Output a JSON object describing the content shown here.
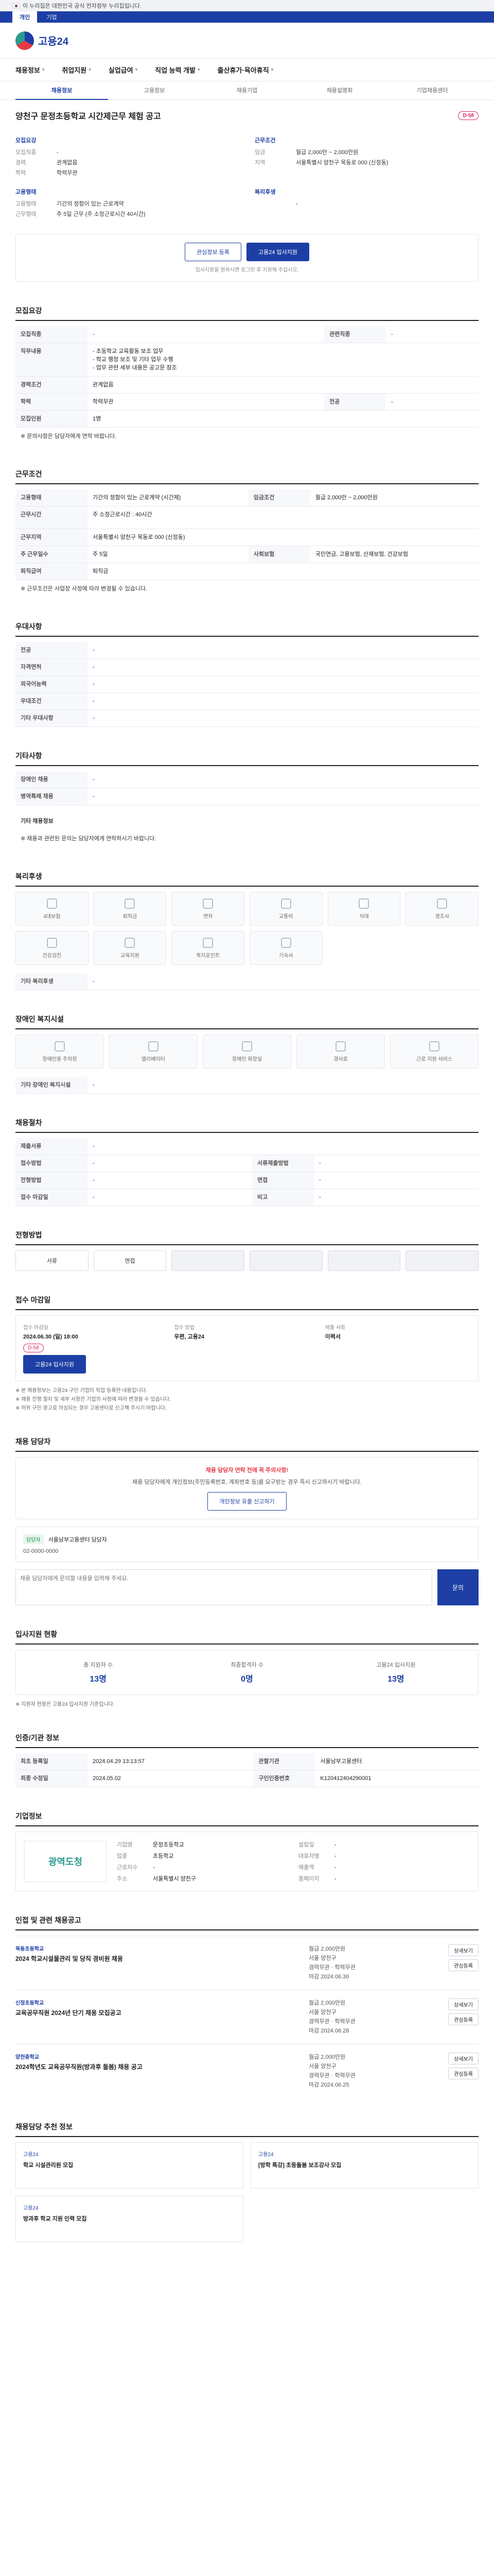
{
  "gov_banner": "이 누리집은 대한민국 공식 전자정부 누리집입니다.",
  "top_tabs": [
    "개인",
    "기업"
  ],
  "logo": "고용24",
  "gnb": [
    "채용정보",
    "취업지원",
    "실업급여",
    "직업 능력 개발",
    "출산휴가·육아휴직"
  ],
  "subtabs": [
    "채용정보",
    "고용정보",
    "채용기업",
    "채용설명회",
    "기업채용센터"
  ],
  "job": {
    "title": "양천구 문정초등학교 시간제근무 체험 공고",
    "dday": "D-58"
  },
  "summary": {
    "left_title": "모집요강",
    "left": [
      {
        "k": "모집직종",
        "v": "-"
      },
      {
        "k": "경력",
        "v": "관계없음"
      },
      {
        "k": "학력",
        "v": "학력무관"
      }
    ],
    "right_title": "근무조건",
    "right": [
      {
        "k": "임금",
        "v": "월급 2,000만 ~ 2,000만원"
      },
      {
        "k": "지역",
        "v": "서울특별시 양천구 목동로 000 (신정동)"
      }
    ],
    "left2_title": "고용형태",
    "left2": [
      {
        "k": "고용형태",
        "v": "기간의 정함이 있는 근로계약"
      },
      {
        "k": "근무형태",
        "v": "주 5일 근무 (주 소정근로시간 40시간)"
      }
    ],
    "right2_title": "복리후생",
    "right2": [
      {
        "k": "",
        "v": "-"
      }
    ]
  },
  "cta": {
    "scrap": "관심정보 등록",
    "apply": "고용24 입사지원",
    "note": "입사지원을 원하시면 로그인 후 지원해 주십시오."
  },
  "recruit_section": {
    "title": "모집요강",
    "rows": [
      {
        "k": "모집직종",
        "v": "-",
        "k2": "관련직종",
        "v2": "-"
      },
      {
        "k": "직무내용",
        "v": "- 초등학교 교육활동 보조 업무\n- 학교 행정 보조 및 기타 업무 수행\n- 업무 관련 세부 내용은 공고문 참조",
        "k2": "",
        "v2": ""
      },
      {
        "k": "경력조건",
        "v": "관계없음",
        "k2": "",
        "v2": ""
      },
      {
        "k": "학력",
        "v": "학력무관",
        "k2": "전공",
        "v2": "-"
      },
      {
        "k": "모집인원",
        "v": "1명",
        "k2": "",
        "v2": ""
      }
    ],
    "note": "※ 문의사항은 담당자에게 연락 바랍니다."
  },
  "condition_section": {
    "title": "근무조건",
    "rows": [
      {
        "k": "고용형태",
        "v": "기간의 정함이 있는 근로계약 (시간제)",
        "k2": "임금조건",
        "v2": "월급 2,000만 ~ 2,000만원"
      },
      {
        "k": "근무시간",
        "v": "주 소정근로시간 : 40시간",
        "k2": "",
        "v2": ""
      },
      {
        "k": "근무지역",
        "v": "서울특별시 양천구 목동로 000 (신정동)",
        "k2": "",
        "v2": ""
      },
      {
        "k": "주 근무일수",
        "v": "주 5일",
        "k2": "사회보험",
        "v2": "국민연금, 고용보험, 산재보험, 건강보험"
      },
      {
        "k": "퇴직급여",
        "v": "퇴직금",
        "k2": "",
        "v2": ""
      }
    ],
    "note": "※ 근무조건은 사업장 사정에 따라 변경될 수 있습니다."
  },
  "qualification_section": {
    "title": "우대사항",
    "rows": [
      {
        "k": "전공",
        "v": "-"
      },
      {
        "k": "자격면허",
        "v": "-"
      },
      {
        "k": "외국어능력",
        "v": "-"
      },
      {
        "k": "우대조건",
        "v": "-"
      },
      {
        "k": "기타 우대사항",
        "v": "-"
      }
    ]
  },
  "other_section": {
    "title": "기타사항",
    "rows": [
      {
        "k": "장애인 채용",
        "v": "-"
      },
      {
        "k": "병역특례 채용",
        "v": "-"
      }
    ],
    "extra_title": "기타 채용정보",
    "extra": "※ 채용과 관련된 문의는 담당자에게 연락하시기 바랍니다."
  },
  "welfare_section": {
    "title": "복리후생",
    "items": [
      "4대보험",
      "퇴직금",
      "연차",
      "교통비",
      "식대",
      "경조사",
      "건강검진",
      "교육지원",
      "복지포인트",
      "기숙사"
    ],
    "extra_label": "기타 복리후생",
    "extra": "-"
  },
  "disability_section": {
    "title": "장애인 복지시설",
    "items": [
      "장애인용 주차장",
      "엘리베이터",
      "장애인 화장실",
      "경사로",
      "근로 지원 서비스"
    ],
    "extra_label": "기타 장애인 복지시설",
    "extra": "-"
  },
  "process_section": {
    "title": "채용절차",
    "rows": [
      {
        "k": "제출서류",
        "v": "-"
      },
      {
        "k": "접수방법",
        "v": "-",
        "k2": "서류제출방법",
        "v2": "-"
      },
      {
        "k": "전형방법",
        "v": "-",
        "k2": "면접",
        "v2": "-"
      },
      {
        "k": "접수 마감일",
        "v": "-",
        "k2": "비고",
        "v2": "-"
      }
    ]
  },
  "steps_section": {
    "title": "전형방법",
    "steps": [
      "서류",
      "면접",
      "",
      "",
      "",
      ""
    ]
  },
  "apply_section": {
    "title": "접수 마감일",
    "items": [
      {
        "lbl": "접수 마감일",
        "val": "2024.06.30 (일) 18:00"
      },
      {
        "lbl": "접수 방법",
        "val": "우편, 고용24"
      },
      {
        "lbl": "제출 서류",
        "val": "이력서"
      }
    ],
    "dday": "D-58",
    "apply_btn": "고용24 입사지원",
    "notes": [
      "※ 본 채용정보는 고용24 구인 기업이 직접 등록한 내용입니다.",
      "※ 채용 진행 절차 및 세부 사항은 기업의 사정에 따라 변경될 수 있습니다.",
      "※ 허위 구인 광고로 의심되는 경우 고용센터로 신고해 주시기 바랍니다."
    ]
  },
  "contact_section": {
    "title": "채용 담당자",
    "warn_head": "채용 담당자 연락 전에 꼭 주의사항!",
    "warn_text": "채용 담당자에게 개인정보(주민등록번호, 계좌번호 등)를 요구받는 경우 즉시 신고하시기 바랍니다.",
    "warn_btn": "개인정보 유출 신고하기",
    "tag": "담당자",
    "contact": "서울남부고용센터 담당자",
    "phone": "02-0000-0000",
    "inquiry_placeholder": "채용 담당자에게 문의할 내용을 입력해 주세요.",
    "send": "문의"
  },
  "stats_section": {
    "title": "입사지원 현황",
    "items": [
      {
        "sl": "총 지원자 수",
        "sv": "13명"
      },
      {
        "sl": "최종합격자 수",
        "sv": "0명"
      },
      {
        "sl": "고용24 입사지원",
        "sv": "13명"
      }
    ],
    "note": "※ 지원자 현황은 고용24 입사지원 기준입니다."
  },
  "info_section": {
    "title": "인증/기관 정보",
    "rows": [
      {
        "k": "최초 등록일",
        "v": "2024.04.29 13:13:57",
        "k2": "관할기관",
        "v2": "서울남부고용센터"
      },
      {
        "k": "최종 수정일",
        "v": "2024.05.02",
        "k2": "구인인증번호",
        "v2": "K120412404290001"
      }
    ]
  },
  "company_section": {
    "title": "기업정보",
    "logo": "광역도청",
    "rows": [
      {
        "k": "기업명",
        "v": "문정초등학교",
        "k2": "설립일",
        "v2": "-"
      },
      {
        "k": "업종",
        "v": "초등학교",
        "k2": "대표자명",
        "v2": "-"
      },
      {
        "k": "근로자수",
        "v": "-",
        "k2": "매출액",
        "v2": "-"
      },
      {
        "k": "주소",
        "v": "서울특별시 양천구",
        "k2": "홈페이지",
        "v2": "-"
      }
    ]
  },
  "related_section": {
    "title": "인접 및 관련 채용공고",
    "items": [
      {
        "org": "목동초등학교",
        "t": "2024 학교시설물관리 및 당직 경비원 채용",
        "meta": [
          "월급 2,000만원",
          "서울 양천구",
          "경력무관 · 학력무관",
          "마감 2024.06.30"
        ]
      },
      {
        "org": "신정초등학교",
        "t": "교육공무직원 2024년 단기 채용 모집공고",
        "meta": [
          "월급 2,000만원",
          "서울 양천구",
          "경력무관 · 학력무관",
          "마감 2024.06.28"
        ]
      },
      {
        "org": "양천중학교",
        "t": "2024학년도 교육공무직원(방과후 돌봄) 채용 공고",
        "meta": [
          "월급 2,000만원",
          "서울 양천구",
          "경력무관 · 학력무관",
          "마감 2024.06.25"
        ]
      }
    ],
    "btn_view": "상세보기",
    "btn_scrap": "관심등록"
  },
  "recommend_section": {
    "title": "채용담당 추천 정보",
    "items": [
      {
        "org": "고용24",
        "t": "학교 시설관리원 모집"
      },
      {
        "org": "고용24",
        "t": "[방학 특강] 초등돌봄 보조강사 모집"
      },
      {
        "org": "고용24",
        "t": "방과후 학교 지원 인력 모집"
      }
    ]
  }
}
